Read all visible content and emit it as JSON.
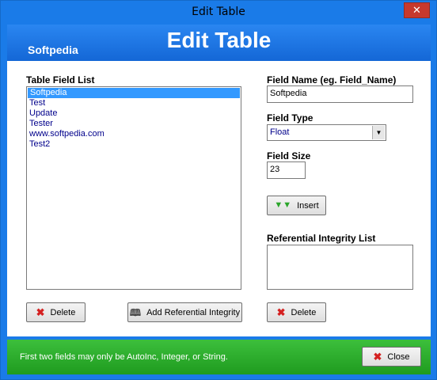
{
  "window": {
    "title": "Edit Table",
    "close_glyph": "✕"
  },
  "header": {
    "brand": "Softpedia",
    "title": "Edit Table"
  },
  "left": {
    "list_label": "Table Field List",
    "fields": [
      "Softpedia",
      "Test",
      "Update",
      "Tester",
      "www.softpedia.com",
      "Test2"
    ],
    "selected_index": 0,
    "delete_label": "Delete",
    "add_ref_label": "Add Referential Integrity"
  },
  "right": {
    "field_name_label": "Field Name (eg. Field_Name)",
    "field_name_value": "Softpedia",
    "field_type_label": "Field Type",
    "field_type_value": "Float",
    "field_size_label": "Field Size",
    "field_size_value": "23",
    "insert_label": "Insert",
    "ref_list_label": "Referential Integrity List",
    "delete_label": "Delete"
  },
  "footer": {
    "message": "First two fields may only be AutoInc, Integer, or String.",
    "close_label": "Close"
  },
  "icons": {
    "delete": "x-icon",
    "insert": "arrow-down-icon",
    "add_ref": "book-icon",
    "close": "x-icon"
  },
  "colors": {
    "frame_blue": "#1a7be8",
    "footer_green": "#2eae2e",
    "selection": "#3399ff",
    "list_text": "#00008b",
    "delete_red": "#d42020"
  }
}
